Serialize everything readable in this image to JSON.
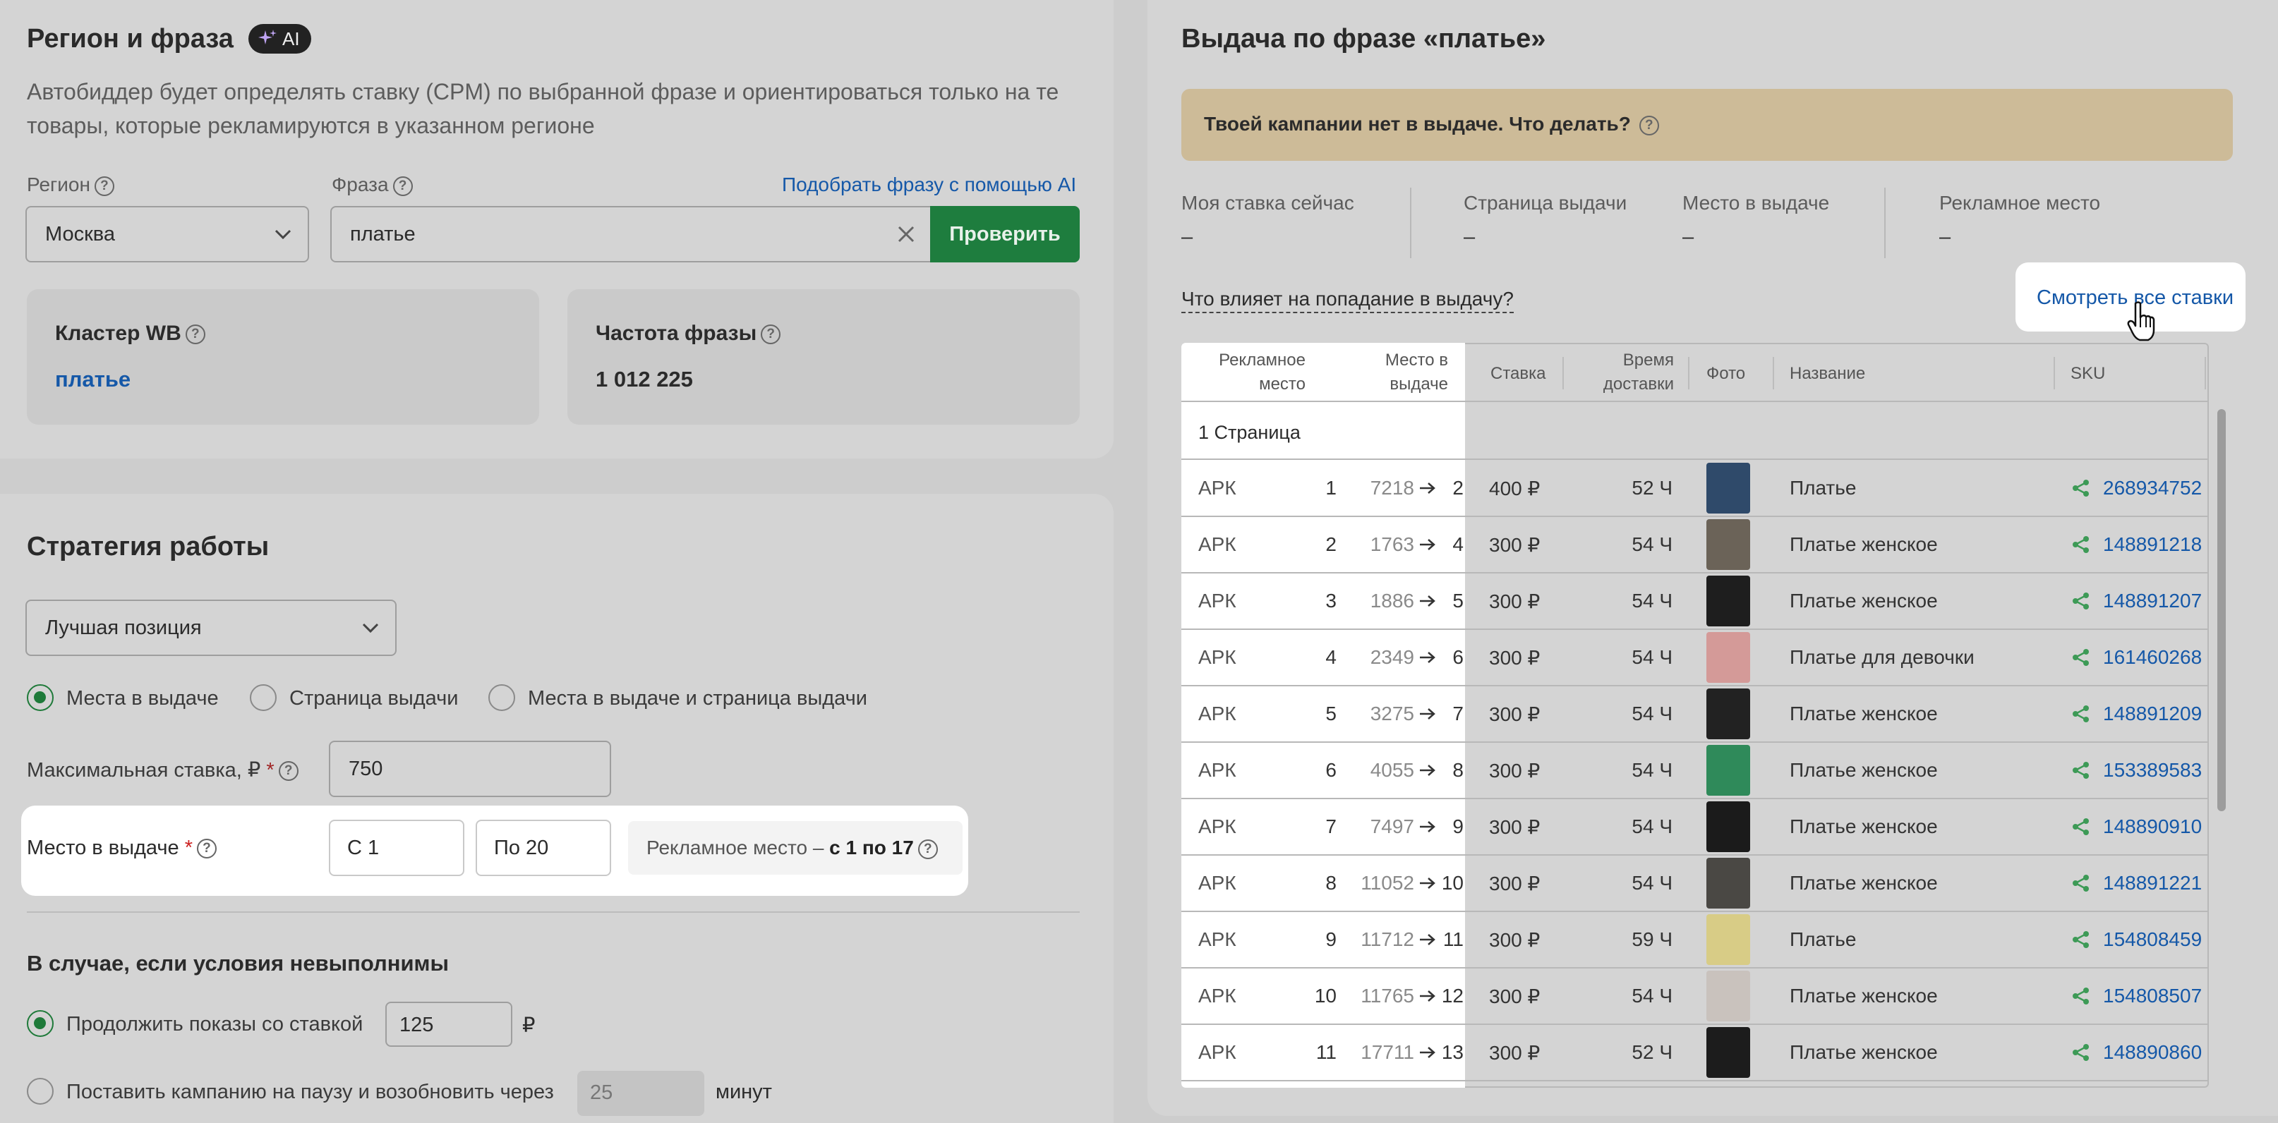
{
  "region_panel": {
    "title": "Регион и фраза",
    "ai_badge": "AI",
    "description": "Автобиддер будет определять ставку (CPM) по выбранной фразе и ориентироваться только на те товары, которые рекламируются в указанном регионе",
    "region_label": "Регион",
    "region_value": "Москва",
    "phrase_label": "Фраза",
    "phrase_value": "платье",
    "ai_link": "Подобрать фразу с помощью AI",
    "check_button": "Проверить",
    "cluster_label": "Кластер WB",
    "cluster_value": "платье",
    "frequency_label": "Частота фразы",
    "frequency_value": "1 012 225"
  },
  "strategy_panel": {
    "title": "Стратегия работы",
    "strategy_value": "Лучшая позиция",
    "radio_options": [
      "Места в выдаче",
      "Страница выдачи",
      "Места в выдаче и страница выдачи"
    ],
    "max_bid_label": "Максимальная ставка, ₽",
    "required_mark": "*",
    "max_bid_value": "750",
    "place_label": "Место в выдаче",
    "place_from": "С 1",
    "place_to": "По 20",
    "ad_place_prefix": "Рекламное место – ",
    "ad_place_range": "с 1 по 17",
    "fail_title": "В случае, если условия невыполнимы",
    "continue_label": "Продолжить показы со ставкой",
    "continue_value": "125",
    "currency": "₽",
    "pause_label": "Поставить кампанию на паузу и возобновить через",
    "pause_value": "25",
    "minutes": "минут"
  },
  "results_panel": {
    "title": "Выдача по фразе «платье»",
    "alert_text": "Твоей кампании нет в выдаче. Что делать?",
    "stats": [
      {
        "label": "Моя ставка сейчас",
        "value": "–"
      },
      {
        "label": "Страница выдачи",
        "value": "–"
      },
      {
        "label": "Место в выдаче",
        "value": "–"
      },
      {
        "label": "Рекламное место",
        "value": "–"
      }
    ],
    "influence_link": "Что влияет на попадание в выдачу?",
    "all_bids_button": "Смотреть все ставки",
    "columns": {
      "ad_place_1": "Рекламное",
      "ad_place_2": "место",
      "place_1": "Место в",
      "place_2": "выдаче",
      "bid": "Ставка",
      "delivery_1": "Время",
      "delivery_2": "доставки",
      "photo": "Фото",
      "name": "Название",
      "sku": "SKU"
    },
    "page_label": "1 Страница",
    "rows": [
      {
        "type": "АРК",
        "ad": "1",
        "from": "7218",
        "to": "2",
        "bid": "400 ₽",
        "time": "52 Ч",
        "name": "Платье",
        "sku": "268934752",
        "photo_color": "#2f4a6a"
      },
      {
        "type": "АРК",
        "ad": "2",
        "from": "1763",
        "to": "4",
        "bid": "300 ₽",
        "time": "54 Ч",
        "name": "Платье женское",
        "sku": "148891218",
        "photo_color": "#6b6358"
      },
      {
        "type": "АРК",
        "ad": "3",
        "from": "1886",
        "to": "5",
        "bid": "300 ₽",
        "time": "54 Ч",
        "name": "Платье женское",
        "sku": "148891207",
        "photo_color": "#1e1e1e"
      },
      {
        "type": "АРК",
        "ad": "4",
        "from": "2349",
        "to": "6",
        "bid": "300 ₽",
        "time": "54 Ч",
        "name": "Платье для девочки",
        "sku": "161460268",
        "photo_color": "#d49a98"
      },
      {
        "type": "АРК",
        "ad": "5",
        "from": "3275",
        "to": "7",
        "bid": "300 ₽",
        "time": "54 Ч",
        "name": "Платье женское",
        "sku": "148891209",
        "photo_color": "#222222"
      },
      {
        "type": "АРК",
        "ad": "6",
        "from": "4055",
        "to": "8",
        "bid": "300 ₽",
        "time": "54 Ч",
        "name": "Платье женское",
        "sku": "153389583",
        "photo_color": "#2f8a5a"
      },
      {
        "type": "АРК",
        "ad": "7",
        "from": "7497",
        "to": "9",
        "bid": "300 ₽",
        "time": "54 Ч",
        "name": "Платье женское",
        "sku": "148890910",
        "photo_color": "#1b1b1b"
      },
      {
        "type": "АРК",
        "ad": "8",
        "from": "11052",
        "to": "10",
        "bid": "300 ₽",
        "time": "54 Ч",
        "name": "Платье женское",
        "sku": "148891221",
        "photo_color": "#4a4844"
      },
      {
        "type": "АРК",
        "ad": "9",
        "from": "11712",
        "to": "11",
        "bid": "300 ₽",
        "time": "59 Ч",
        "name": "Платье",
        "sku": "154808459",
        "photo_color": "#d8cc86"
      },
      {
        "type": "АРК",
        "ad": "10",
        "from": "11765",
        "to": "12",
        "bid": "300 ₽",
        "time": "54 Ч",
        "name": "Платье женское",
        "sku": "154808507",
        "photo_color": "#c9c2bd"
      },
      {
        "type": "АРК",
        "ad": "11",
        "from": "17711",
        "to": "13",
        "bid": "300 ₽",
        "time": "52 Ч",
        "name": "Платье женское",
        "sku": "148890860",
        "photo_color": "#1c1c1c"
      }
    ]
  },
  "colors": {
    "accent_green": "#1e7d3e",
    "link_blue": "#1558a8",
    "alert_bg": "#cdbb98",
    "share_green": "#3d9a56"
  }
}
